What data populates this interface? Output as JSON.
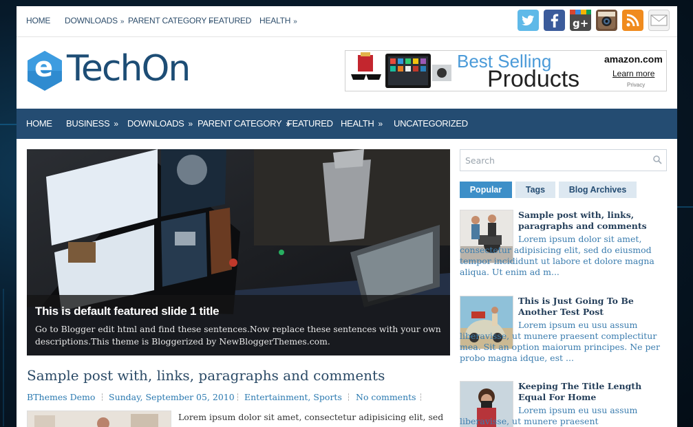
{
  "top_nav": {
    "items": [
      {
        "label": "HOME",
        "submenu": false
      },
      {
        "label": "DOWNLOADS",
        "submenu": true
      },
      {
        "label": "PARENT CATEGORY",
        "submenu": true
      },
      {
        "label": "FEATURED",
        "submenu": false
      },
      {
        "label": "HEALTH",
        "submenu": true
      }
    ],
    "social_icons": [
      "twitter-icon",
      "facebook-icon",
      "google-plus-icon",
      "instagram-icon",
      "rss-icon",
      "email-icon"
    ]
  },
  "header": {
    "logo_text": "TechOn",
    "logo_letter": "e"
  },
  "ad": {
    "line1": "Best Selling",
    "line2": "Products",
    "brand": "amazon.com",
    "cta": "Learn more",
    "privacy": "Privacy"
  },
  "main_nav": {
    "items": [
      {
        "label": "HOME",
        "submenu": false
      },
      {
        "label": "BUSINESS",
        "submenu": true
      },
      {
        "label": "DOWNLOADS",
        "submenu": true
      },
      {
        "label": "PARENT CATEGORY",
        "submenu": true
      },
      {
        "label": "FEATURED",
        "submenu": false
      },
      {
        "label": "HEALTH",
        "submenu": true
      },
      {
        "label": "UNCATEGORIZED",
        "submenu": false
      }
    ]
  },
  "slider": {
    "title": "This is default featured slide 1 title",
    "description": "Go to Blogger edit html and find these sentences.Now replace these sentences with your own descriptions.This theme is Bloggerized by NewBloggerThemes.com."
  },
  "post": {
    "title": "Sample post with, links, paragraphs and comments",
    "author": "BThemes Demo",
    "date": "Sunday, September 05, 2010",
    "categories": "Entertainment, Sports",
    "comments": "No comments",
    "excerpt": "Lorem ipsum dolor sit amet, consectetur adipisicing elit, sed"
  },
  "sidebar": {
    "search_placeholder": "Search",
    "tabs": [
      {
        "label": "Popular",
        "active": true
      },
      {
        "label": "Tags",
        "active": false
      },
      {
        "label": "Blog Archives",
        "active": false
      }
    ],
    "posts": [
      {
        "title": "Sample post with, links, paragraphs and comments",
        "excerpt": "Lorem ipsum dolor sit amet, consectetur adipisicing elit, sed do eiusmod tempor incididunt ut labore et dolore magna aliqua. Ut enim ad m..."
      },
      {
        "title": "This is Just Going To Be Another Test Post",
        "excerpt": "Lorem ipsum eu usu assum liberavisse, ut munere praesent complectitur mea. Sit an option maiorum principes. Ne per probo magna idque, est ..."
      },
      {
        "title": "Keeping The Title Length Equal For Home",
        "excerpt": "Lorem ipsum eu usu assum liberavisse, ut munere praesent"
      }
    ]
  },
  "colors": {
    "nav_bar": "#244c72",
    "accent": "#3d8fc8",
    "link": "#2a79b0"
  }
}
